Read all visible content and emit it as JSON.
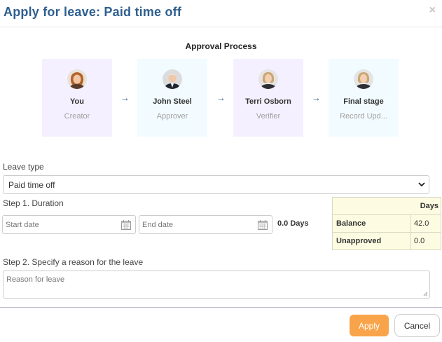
{
  "dialog": {
    "title": "Apply for leave: Paid time off",
    "close_icon": "close-icon"
  },
  "approval": {
    "title": "Approval Process",
    "steps": [
      {
        "name": "You",
        "role": "Creator",
        "avatar": "avatar-woman-redhead"
      },
      {
        "name": "John Steel",
        "role": "Approver",
        "avatar": "avatar-man-suit"
      },
      {
        "name": "Terri Osborn",
        "role": "Verifier",
        "avatar": "avatar-woman-blonde"
      },
      {
        "name": "Final stage",
        "role": "Record Upd...",
        "avatar": "avatar-woman-blonde"
      }
    ],
    "arrow": "→"
  },
  "leave_type": {
    "label": "Leave type",
    "selected": "Paid time off"
  },
  "duration": {
    "label": "Step 1. Duration",
    "start_placeholder": "Start date",
    "end_placeholder": "End date",
    "total": "0.0 Days"
  },
  "balance_table": {
    "header": "Days",
    "rows": [
      {
        "label": "Balance",
        "value": "42.0"
      },
      {
        "label": "Unapproved",
        "value": "0.0"
      }
    ]
  },
  "reason": {
    "label": "Step 2. Specify a reason for the leave",
    "placeholder": "Reason for leave"
  },
  "buttons": {
    "apply": "Apply",
    "cancel": "Cancel"
  },
  "colors": {
    "title": "#2e5f8f",
    "apply_button": "#f9a44a",
    "card_purple": "#f5f0ff",
    "card_blue": "#f2fbff",
    "balance_bg": "#fdfbe1"
  }
}
